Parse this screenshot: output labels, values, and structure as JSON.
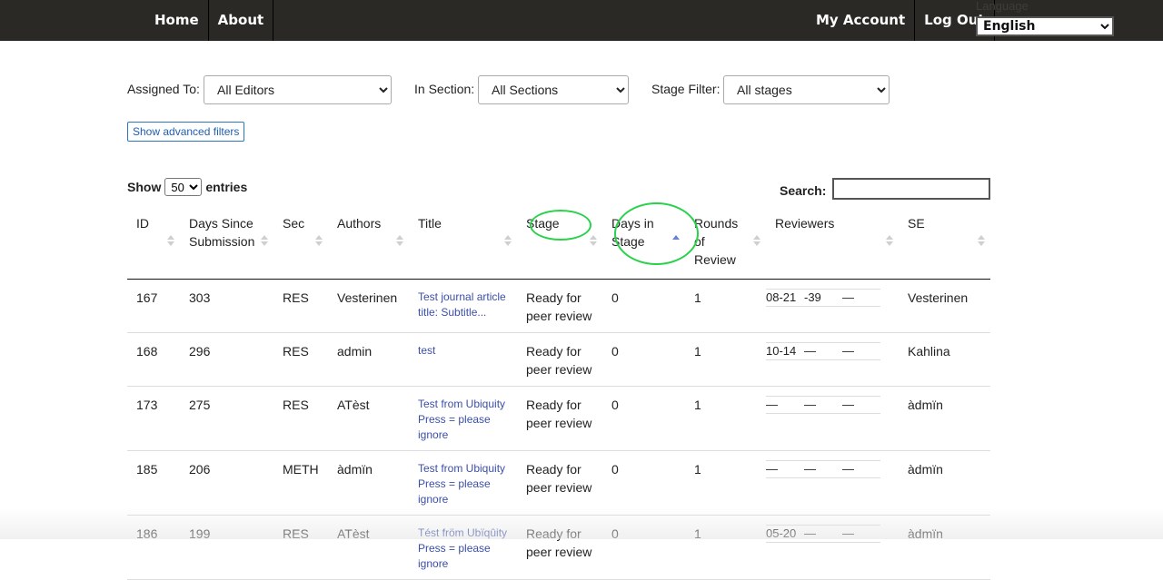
{
  "nav": {
    "home": "Home",
    "about": "About",
    "my_account": "My Account",
    "log_out": "Log Out",
    "language_label": "Language",
    "language_value": "English"
  },
  "filters": {
    "assigned_label": "Assigned To:",
    "assigned_value": "All Editors",
    "section_label": "In Section:",
    "section_value": "All Sections",
    "stage_label": "Stage Filter:",
    "stage_value": "All stages",
    "advanced_button": "Show advanced filters"
  },
  "table_controls": {
    "show_label": "Show",
    "entries_value": "50",
    "entries_label": "entries",
    "search_label": "Search:"
  },
  "columns": [
    "ID",
    "Days Since Submission",
    "Sec",
    "Authors",
    "Title",
    "Stage",
    "Days in Stage",
    "Rounds of Review",
    "Reviewers",
    "SE"
  ],
  "rows": [
    {
      "id": "167",
      "days": "303",
      "sec": "RES",
      "authors": "Vesterinen",
      "title": "Test journal article title: Subtitle...",
      "stage": "Ready for peer review",
      "days_in_stage": "0",
      "rounds": "1",
      "reviewers": [
        "08-21",
        "-39",
        "—"
      ],
      "se": "Vesterinen"
    },
    {
      "id": "168",
      "days": "296",
      "sec": "RES",
      "authors": "admin",
      "title": "test",
      "stage": "Ready for peer review",
      "days_in_stage": "0",
      "rounds": "1",
      "reviewers": [
        "10-14",
        "—",
        "—"
      ],
      "se": "Kahlina"
    },
    {
      "id": "173",
      "days": "275",
      "sec": "RES",
      "authors": "ATèst",
      "title": "Test from Ubiquity Press = please ignore",
      "stage": "Ready for peer review",
      "days_in_stage": "0",
      "rounds": "1",
      "reviewers": [
        "—",
        "—",
        "—"
      ],
      "se": "àdmïn"
    },
    {
      "id": "185",
      "days": "206",
      "sec": "METH",
      "authors": "àdmïn",
      "title": "Test from Ubiquity Press = please ignore",
      "stage": "Ready for peer review",
      "days_in_stage": "0",
      "rounds": "1",
      "reviewers": [
        "—",
        "—",
        "—"
      ],
      "se": "àdmïn"
    },
    {
      "id": "186",
      "days": "199",
      "sec": "RES",
      "authors": "ATèst",
      "title": "Tést fröm Ubïqûity Press = please ignore",
      "stage": "Ready for peer review",
      "days_in_stage": "0",
      "rounds": "1",
      "reviewers": [
        "05-20",
        "—",
        "—"
      ],
      "se": "àdmïn"
    }
  ],
  "colors": {
    "topbar": "#2a2925",
    "link": "#3b4fa8",
    "highlight": "#29d24a"
  }
}
